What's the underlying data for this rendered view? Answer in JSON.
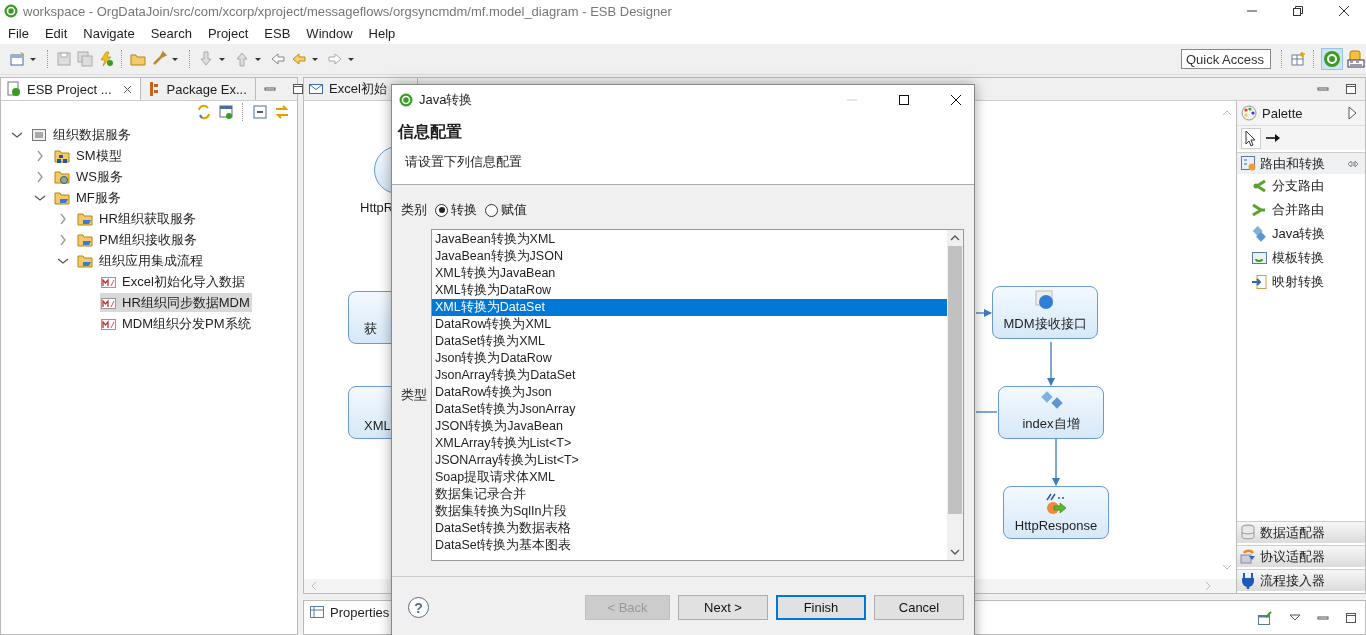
{
  "window": {
    "title": "workspace - OrgDataJoin/src/com/xcorp/xproject/messageflows/orgsyncmdm/mf.model_diagram - ESB Designer"
  },
  "menu": [
    "File",
    "Edit",
    "Navigate",
    "Search",
    "Project",
    "ESB",
    "Window",
    "Help"
  ],
  "toolbar": {
    "quick_access": {
      "placeholder": "Quick Access"
    }
  },
  "left_panel": {
    "tabs": [
      {
        "label": "ESB Project ...",
        "selected": true
      },
      {
        "label": "Package Ex...",
        "selected": false
      }
    ],
    "tree": [
      {
        "label": "组织数据服务",
        "kind": "project",
        "expanded": true,
        "selected": false,
        "children": [
          {
            "label": "SM模型",
            "kind": "model",
            "expanded": false,
            "selected": false
          },
          {
            "label": "WS服务",
            "kind": "service",
            "expanded": false,
            "selected": false
          },
          {
            "label": "MF服务",
            "kind": "folder",
            "expanded": true,
            "selected": false,
            "children": [
              {
                "label": "HR组织获取服务",
                "kind": "folder",
                "expanded": false,
                "selected": false
              },
              {
                "label": "PM组织接收服务",
                "kind": "folder",
                "expanded": false,
                "selected": false
              },
              {
                "label": "组织应用集成流程",
                "kind": "folder",
                "expanded": true,
                "selected": false,
                "children": [
                  {
                    "label": "Excel初始化导入数据",
                    "kind": "diagram",
                    "selected": false
                  },
                  {
                    "label": "HR组织同步数据MDM",
                    "kind": "diagram",
                    "selected": true
                  },
                  {
                    "label": "MDM组织分发PM系统",
                    "kind": "diagram",
                    "selected": false
                  }
                ]
              }
            ]
          }
        ]
      }
    ]
  },
  "editor": {
    "tabs": [
      {
        "label": "Excel初始",
        "selected": false
      }
    ],
    "nodes": [
      {
        "label": "HttpR",
        "kind": "http-request"
      },
      {
        "label": "获",
        "kind": "step"
      },
      {
        "label": "XML",
        "kind": "step"
      },
      {
        "label": "MDM接收接口",
        "kind": "web-service"
      },
      {
        "label": "index自增",
        "kind": "java-transform"
      },
      {
        "label": "HttpResponse",
        "kind": "http-response"
      }
    ]
  },
  "palette": {
    "title": "Palette",
    "drawers": [
      {
        "label": "路由和转换",
        "expanded": true,
        "items": [
          {
            "label": "分支路由",
            "kind": "branch"
          },
          {
            "label": "合并路由",
            "kind": "merge"
          },
          {
            "label": "Java转换",
            "kind": "java"
          },
          {
            "label": "模板转换",
            "kind": "template"
          },
          {
            "label": "映射转换",
            "kind": "mapping"
          }
        ]
      },
      {
        "label": "数据适配器",
        "expanded": false
      },
      {
        "label": "协议适配器",
        "expanded": false
      },
      {
        "label": "流程接入器",
        "expanded": false
      }
    ]
  },
  "bottom_panel": {
    "tabs": [
      {
        "label": "Properties",
        "selected": true
      }
    ]
  },
  "dialog": {
    "title": "Java转换",
    "heading": "信息配置",
    "description": "请设置下列信息配置",
    "category": {
      "label": "类别",
      "options": [
        {
          "label": "转换",
          "selected": true
        },
        {
          "label": "赋值",
          "selected": false
        }
      ]
    },
    "type": {
      "label": "类型",
      "items": [
        {
          "label": "JavaBean转换为XML",
          "selected": false
        },
        {
          "label": "JavaBean转换为JSON",
          "selected": false
        },
        {
          "label": "XML转换为JavaBean",
          "selected": false
        },
        {
          "label": "XML转换为DataRow",
          "selected": false
        },
        {
          "label": "XML转换为DataSet",
          "selected": true
        },
        {
          "label": "DataRow转换为XML",
          "selected": false
        },
        {
          "label": "DataSet转换为XML",
          "selected": false
        },
        {
          "label": "Json转换为DataRow",
          "selected": false
        },
        {
          "label": "JsonArray转换为DataSet",
          "selected": false
        },
        {
          "label": "DataRow转换为Json",
          "selected": false
        },
        {
          "label": "DataSet转换为JsonArray",
          "selected": false
        },
        {
          "label": "JSON转换为JavaBean",
          "selected": false
        },
        {
          "label": "XMLArray转换为List<T>",
          "selected": false
        },
        {
          "label": "JSONArray转换为List<T>",
          "selected": false
        },
        {
          "label": "Soap提取请求体XML",
          "selected": false
        },
        {
          "label": "数据集记录合并",
          "selected": false
        },
        {
          "label": "数据集转换为SqlIn片段",
          "selected": false
        },
        {
          "label": "DataSet转换为数据表格",
          "selected": false
        },
        {
          "label": "DataSet转换为基本图表",
          "selected": false
        }
      ]
    },
    "help": {
      "label": "?"
    },
    "buttons": [
      {
        "label": "< Back",
        "disabled": true,
        "default": false
      },
      {
        "label": "Next >",
        "disabled": false,
        "default": false
      },
      {
        "label": "Finish",
        "disabled": false,
        "default": true
      },
      {
        "label": "Cancel",
        "disabled": false,
        "default": false
      }
    ]
  }
}
